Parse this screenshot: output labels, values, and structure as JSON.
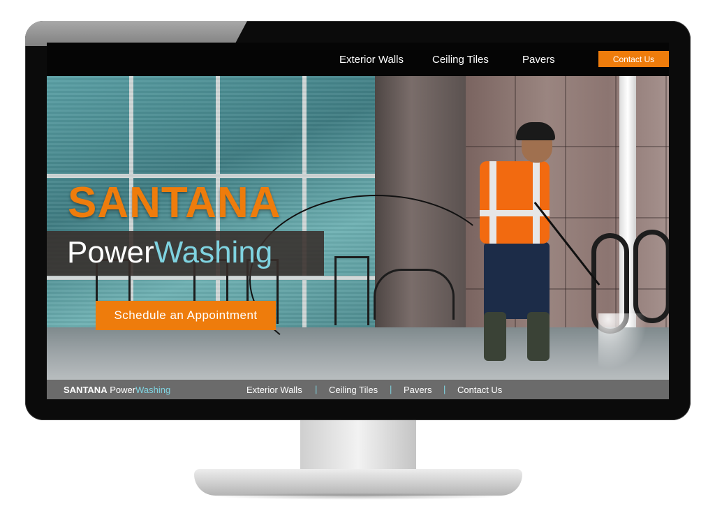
{
  "top_nav": {
    "links": [
      "Exterior Walls",
      "Ceiling Tiles",
      "Pavers"
    ],
    "contact_label": "Contact Us"
  },
  "hero": {
    "title": "SANTANA",
    "subtitle_part1": "Power",
    "subtitle_part2": "Washing",
    "cta_label": "Schedule an Appointment"
  },
  "footer": {
    "logo_bold": "SANTANA",
    "logo_part1": "Power",
    "logo_part2": "Washing",
    "links": [
      "Exterior Walls",
      "Ceiling Tiles",
      "Pavers",
      "Contact Us"
    ],
    "separator": "|"
  },
  "colors": {
    "accent_orange": "#ee7c0c",
    "accent_cyan": "#7fd3e0"
  }
}
